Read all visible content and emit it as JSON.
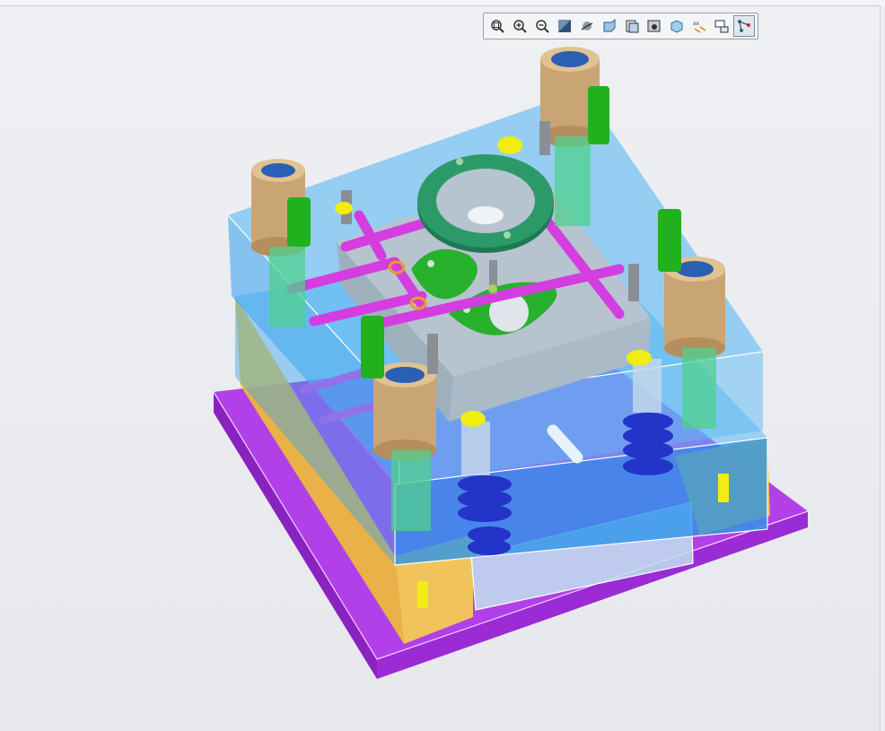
{
  "toolbar": {
    "buttons": [
      {
        "icon": "refit-icon",
        "name": "refit-button"
      },
      {
        "icon": "zoom-in-icon",
        "name": "zoom-in-button"
      },
      {
        "icon": "zoom-out-icon",
        "name": "zoom-out-button"
      },
      {
        "icon": "repaint-icon",
        "name": "repaint-button"
      },
      {
        "icon": "spin-center-icon",
        "name": "spin-center-button"
      },
      {
        "icon": "view-orient-icon",
        "name": "view-orient-button"
      },
      {
        "icon": "saved-views-icon",
        "name": "saved-views-button"
      },
      {
        "icon": "view-manager-icon",
        "name": "view-manager-button"
      },
      {
        "icon": "display-style-icon",
        "name": "display-style-button"
      },
      {
        "icon": "datum-display-icon",
        "name": "datum-display-button"
      },
      {
        "icon": "annotation-display-icon",
        "name": "annotation-display-button"
      },
      {
        "icon": "explode-view-icon",
        "name": "explode-view-button",
        "active": true
      }
    ]
  },
  "colors": {
    "background": "#e9ebee",
    "clamp_plate": "#b240e8",
    "mold_plate": "#3fa7ef",
    "support_block": "#f2c52a",
    "guide_bushing": "#c9a574",
    "bolt": "#22b11e",
    "cooling_line": "#d43de0",
    "locating_ring": "#1f7a52",
    "spring": "#2334c8"
  }
}
